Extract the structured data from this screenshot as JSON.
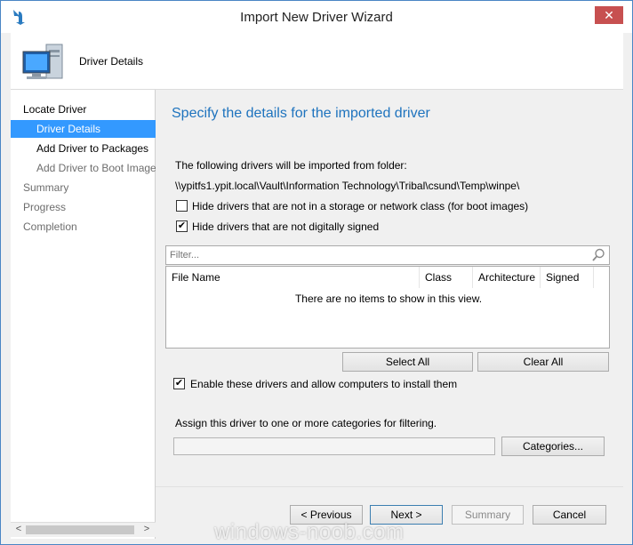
{
  "window": {
    "title": "Import New Driver Wizard",
    "close_symbol": "✕"
  },
  "header": {
    "title": "Driver Details",
    "icon": "computer-icon"
  },
  "nav": {
    "items": [
      {
        "label": "Locate Driver"
      },
      {
        "label": "Driver Details"
      },
      {
        "label": "Add Driver to Packages"
      },
      {
        "label": "Add Driver to Boot Images"
      },
      {
        "label": "Summary"
      },
      {
        "label": "Progress"
      },
      {
        "label": "Completion"
      }
    ],
    "scroll_left": "<",
    "scroll_right": ">"
  },
  "main": {
    "heading": "Specify the details for the imported driver",
    "folder_label": "The following drivers will be imported from folder:",
    "folder_path": "\\\\ypitfs1.ypit.local\\Vault\\Information Technology\\Tribal\\csund\\Temp\\winpe\\",
    "checkbox_storage": {
      "label": "Hide drivers that are not in a storage or network class (for boot images)",
      "checked": false
    },
    "checkbox_signed": {
      "label": "Hide drivers that are not digitally signed",
      "checked": true
    },
    "filter_placeholder": "Filter...",
    "columns": [
      "File Name",
      "Class",
      "Architecture",
      "Signed"
    ],
    "empty_message": "There are no items to show in this view.",
    "select_all": "Select All",
    "clear_all": "Clear All",
    "checkbox_enable": {
      "label": "Enable these drivers and allow computers to install them",
      "checked": true
    },
    "categories_label": "Assign this driver to one or more categories for filtering.",
    "categories_value": "",
    "categories_button": "Categories..."
  },
  "footer": {
    "previous": "< Previous",
    "next": "Next >",
    "summary": "Summary",
    "cancel": "Cancel"
  },
  "watermark": "windows-noob.com",
  "colors": {
    "accent": "#1e73be",
    "selection": "#3399ff",
    "close": "#c75050"
  }
}
